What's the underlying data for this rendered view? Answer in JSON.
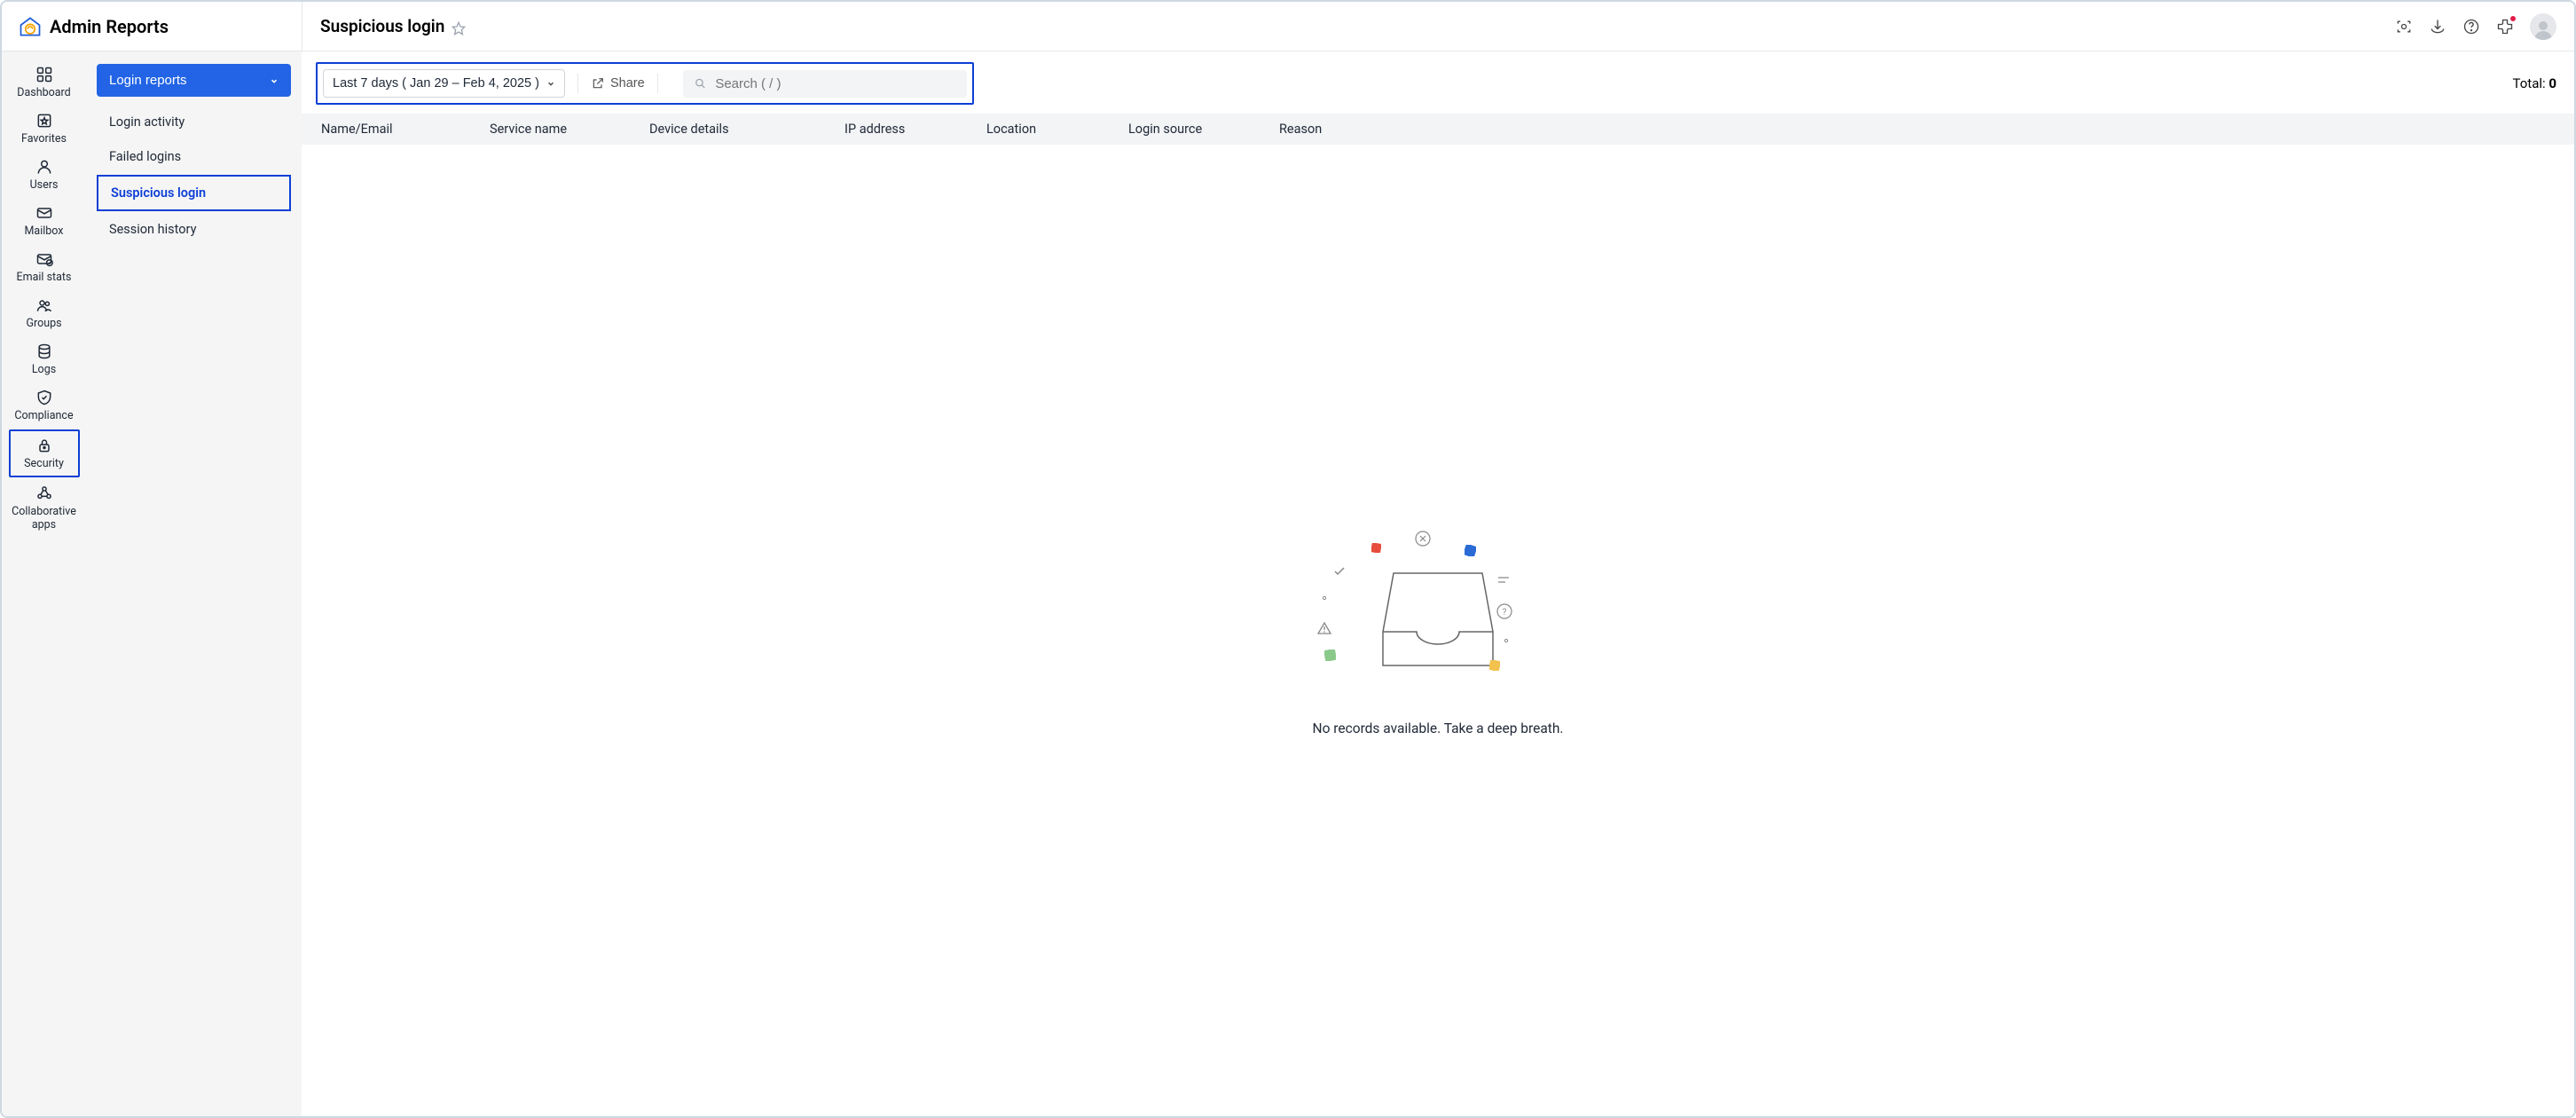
{
  "brand": {
    "title": "Admin Reports"
  },
  "page": {
    "title": "Suspicious login"
  },
  "header_icons": [
    "camera",
    "download",
    "help",
    "puzzle"
  ],
  "sidebar": {
    "items": [
      {
        "label": "Dashboard",
        "icon": "dashboard"
      },
      {
        "label": "Favorites",
        "icon": "favorites"
      },
      {
        "label": "Users",
        "icon": "users"
      },
      {
        "label": "Mailbox",
        "icon": "mailbox"
      },
      {
        "label": "Email stats",
        "icon": "email-stats"
      },
      {
        "label": "Groups",
        "icon": "groups"
      },
      {
        "label": "Logs",
        "icon": "logs"
      },
      {
        "label": "Compliance",
        "icon": "compliance"
      },
      {
        "label": "Security",
        "icon": "security",
        "highlighted": true
      },
      {
        "label": "Collaborative apps",
        "icon": "collab"
      }
    ]
  },
  "secondary_nav": {
    "dropdown_label": "Login reports",
    "items": [
      {
        "label": "Login activity"
      },
      {
        "label": "Failed logins"
      },
      {
        "label": "Suspicious login",
        "active": true
      },
      {
        "label": "Session history"
      }
    ]
  },
  "toolbar": {
    "date_range_label": "Last 7 days ( Jan 29 – Feb 4, 2025 )",
    "share_label": "Share",
    "search_placeholder": "Search ( / )",
    "total_label": "Total:",
    "total_value": "0"
  },
  "table": {
    "columns": [
      "Name/Email",
      "Service name",
      "Device details",
      "IP address",
      "Location",
      "Login source",
      "Reason"
    ]
  },
  "empty_state": {
    "message": "No records available. Take a deep breath."
  }
}
